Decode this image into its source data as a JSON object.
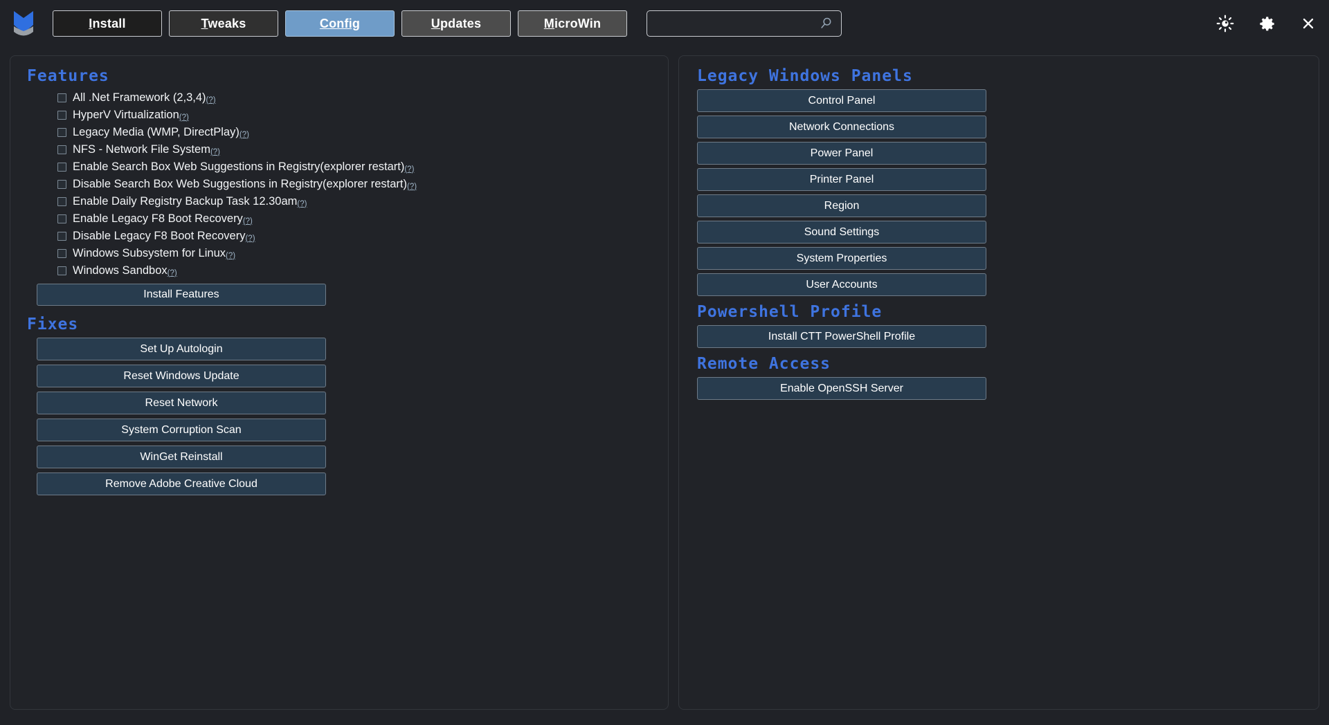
{
  "app": {
    "logo_name": "winutil-logo",
    "window_controls": [
      {
        "name": "theme-toggle-icon",
        "icon": "sun-icon",
        "label": "Toggle Theme"
      },
      {
        "name": "settings-icon",
        "icon": "gear-icon",
        "label": "Settings"
      },
      {
        "name": "close-icon",
        "icon": "close-x-icon",
        "label": "Close"
      }
    ]
  },
  "tabs": [
    {
      "label": "Install",
      "accel": "I",
      "style": "dark",
      "active": false
    },
    {
      "label": "Tweaks",
      "accel": "T",
      "style": "dark2",
      "active": false
    },
    {
      "label": "Config",
      "accel": "C",
      "style": "active",
      "active": true
    },
    {
      "label": "Updates",
      "accel": "U",
      "style": "gray",
      "active": false
    },
    {
      "label": "MicroWin",
      "accel": "M",
      "style": "gray",
      "active": false
    }
  ],
  "search": {
    "value": "",
    "placeholder": "",
    "icon": "search-icon"
  },
  "left": {
    "features": {
      "heading": "Features",
      "help_marker": "(?)",
      "items": [
        {
          "label": "All .Net Framework (2,3,4)",
          "checked": false
        },
        {
          "label": "HyperV Virtualization",
          "checked": false
        },
        {
          "label": "Legacy Media (WMP, DirectPlay)",
          "checked": false
        },
        {
          "label": "NFS - Network File System",
          "checked": false
        },
        {
          "label": "Enable Search Box Web Suggestions in Registry(explorer restart)",
          "checked": false
        },
        {
          "label": "Disable Search Box Web Suggestions in Registry(explorer restart)",
          "checked": false
        },
        {
          "label": "Enable Daily Registry Backup Task 12.30am",
          "checked": false
        },
        {
          "label": "Enable Legacy F8 Boot Recovery",
          "checked": false
        },
        {
          "label": "Disable Legacy F8 Boot Recovery",
          "checked": false
        },
        {
          "label": "Windows Subsystem for Linux",
          "checked": false
        },
        {
          "label": "Windows Sandbox",
          "checked": false
        }
      ],
      "install_button": "Install Features"
    },
    "fixes": {
      "heading": "Fixes",
      "buttons": [
        "Set Up Autologin",
        "Reset Windows Update",
        "Reset Network",
        "System Corruption Scan",
        "WinGet Reinstall",
        "Remove Adobe Creative Cloud"
      ]
    }
  },
  "right": {
    "legacy_panels": {
      "heading": "Legacy Windows Panels",
      "buttons": [
        "Control Panel",
        "Network Connections",
        "Power Panel",
        "Printer Panel",
        "Region",
        "Sound Settings",
        "System Properties",
        "User Accounts"
      ]
    },
    "powershell_profile": {
      "heading": "Powershell Profile",
      "buttons": [
        "Install CTT PowerShell Profile"
      ]
    },
    "remote_access": {
      "heading": "Remote Access",
      "buttons": [
        "Enable OpenSSH Server"
      ]
    }
  },
  "colors": {
    "background": "#202227",
    "panel": "#212328",
    "accent_heading": "#3f74e0",
    "active_tab": "#6f9cc8",
    "action_button": "#283c4e",
    "text": "#f2f4f6"
  }
}
